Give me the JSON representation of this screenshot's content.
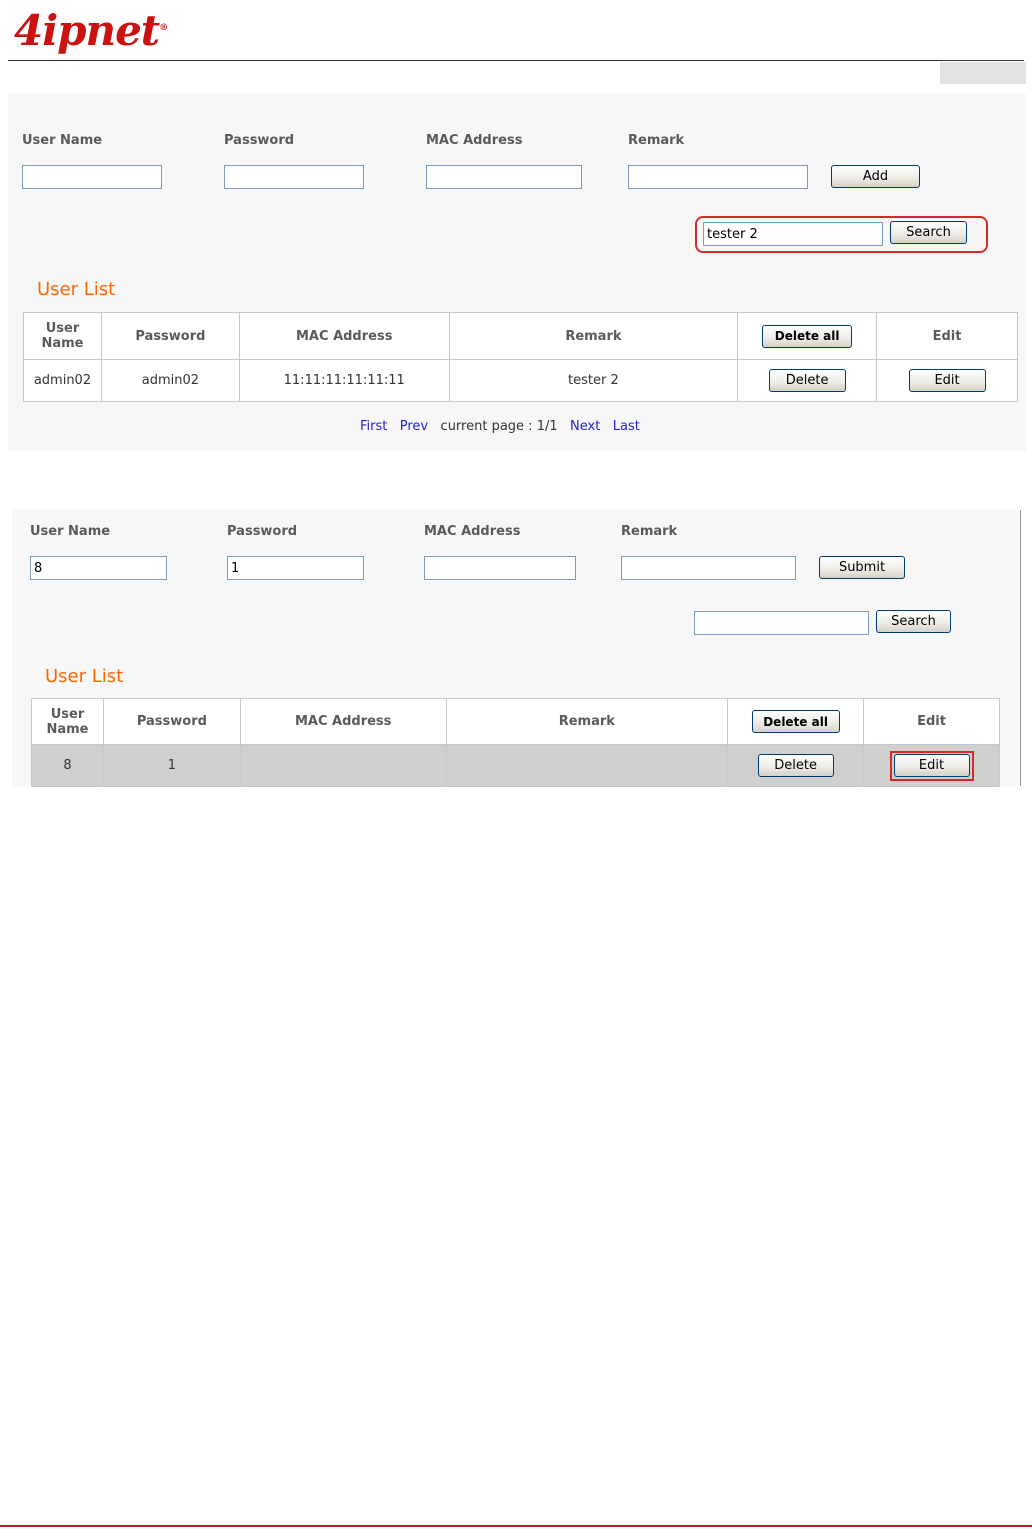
{
  "header": {
    "logo_text": "4ipnet",
    "logo_mark": "®",
    "brand_color": "#cc1111",
    "footer_rule_color": "#b22222"
  },
  "accent": {
    "section_title_color": "#ff6600",
    "link_color": "#2222cc",
    "highlight_color": "#d62a2a"
  },
  "shot1": {
    "labels": {
      "user_name": "User Name",
      "password": "Password",
      "mac_address": "MAC Address",
      "remark": "Remark"
    },
    "inputs": {
      "user_name": "",
      "password": "",
      "mac_address": "",
      "remark": ""
    },
    "add_label": "Add",
    "search_value": "tester 2",
    "search_label": "Search",
    "section_title": "User List",
    "table": {
      "headers": {
        "user_name": "User Name",
        "password": "Password",
        "mac_address": "MAC Address",
        "remark": "Remark",
        "delete_all": "Delete all",
        "edit": "Edit"
      },
      "rows": [
        {
          "user_name": "admin02",
          "password": "admin02",
          "mac_address": "11:11:11:11:11:11",
          "remark": "tester 2",
          "delete": "Delete",
          "edit": "Edit"
        }
      ]
    },
    "pager": {
      "first": "First",
      "prev": "Prev",
      "current_page": "current page : 1/1",
      "next": "Next",
      "last": "Last"
    }
  },
  "shot2": {
    "labels": {
      "user_name": "User Name",
      "password": "Password",
      "mac_address": "MAC Address",
      "remark": "Remark"
    },
    "inputs": {
      "user_name": "8",
      "password": "1",
      "mac_address": "",
      "remark": ""
    },
    "submit_label": "Submit",
    "search_value": "",
    "search_label": "Search",
    "section_title": "User List",
    "table": {
      "headers": {
        "user_name": "User Name",
        "password": "Password",
        "mac_address": "MAC Address",
        "remark": "Remark",
        "delete_all": "Delete all",
        "edit": "Edit"
      },
      "rows": [
        {
          "user_name": "8",
          "password": "1",
          "mac_address": "",
          "remark": "",
          "delete": "Delete",
          "edit": "Edit"
        }
      ]
    }
  }
}
